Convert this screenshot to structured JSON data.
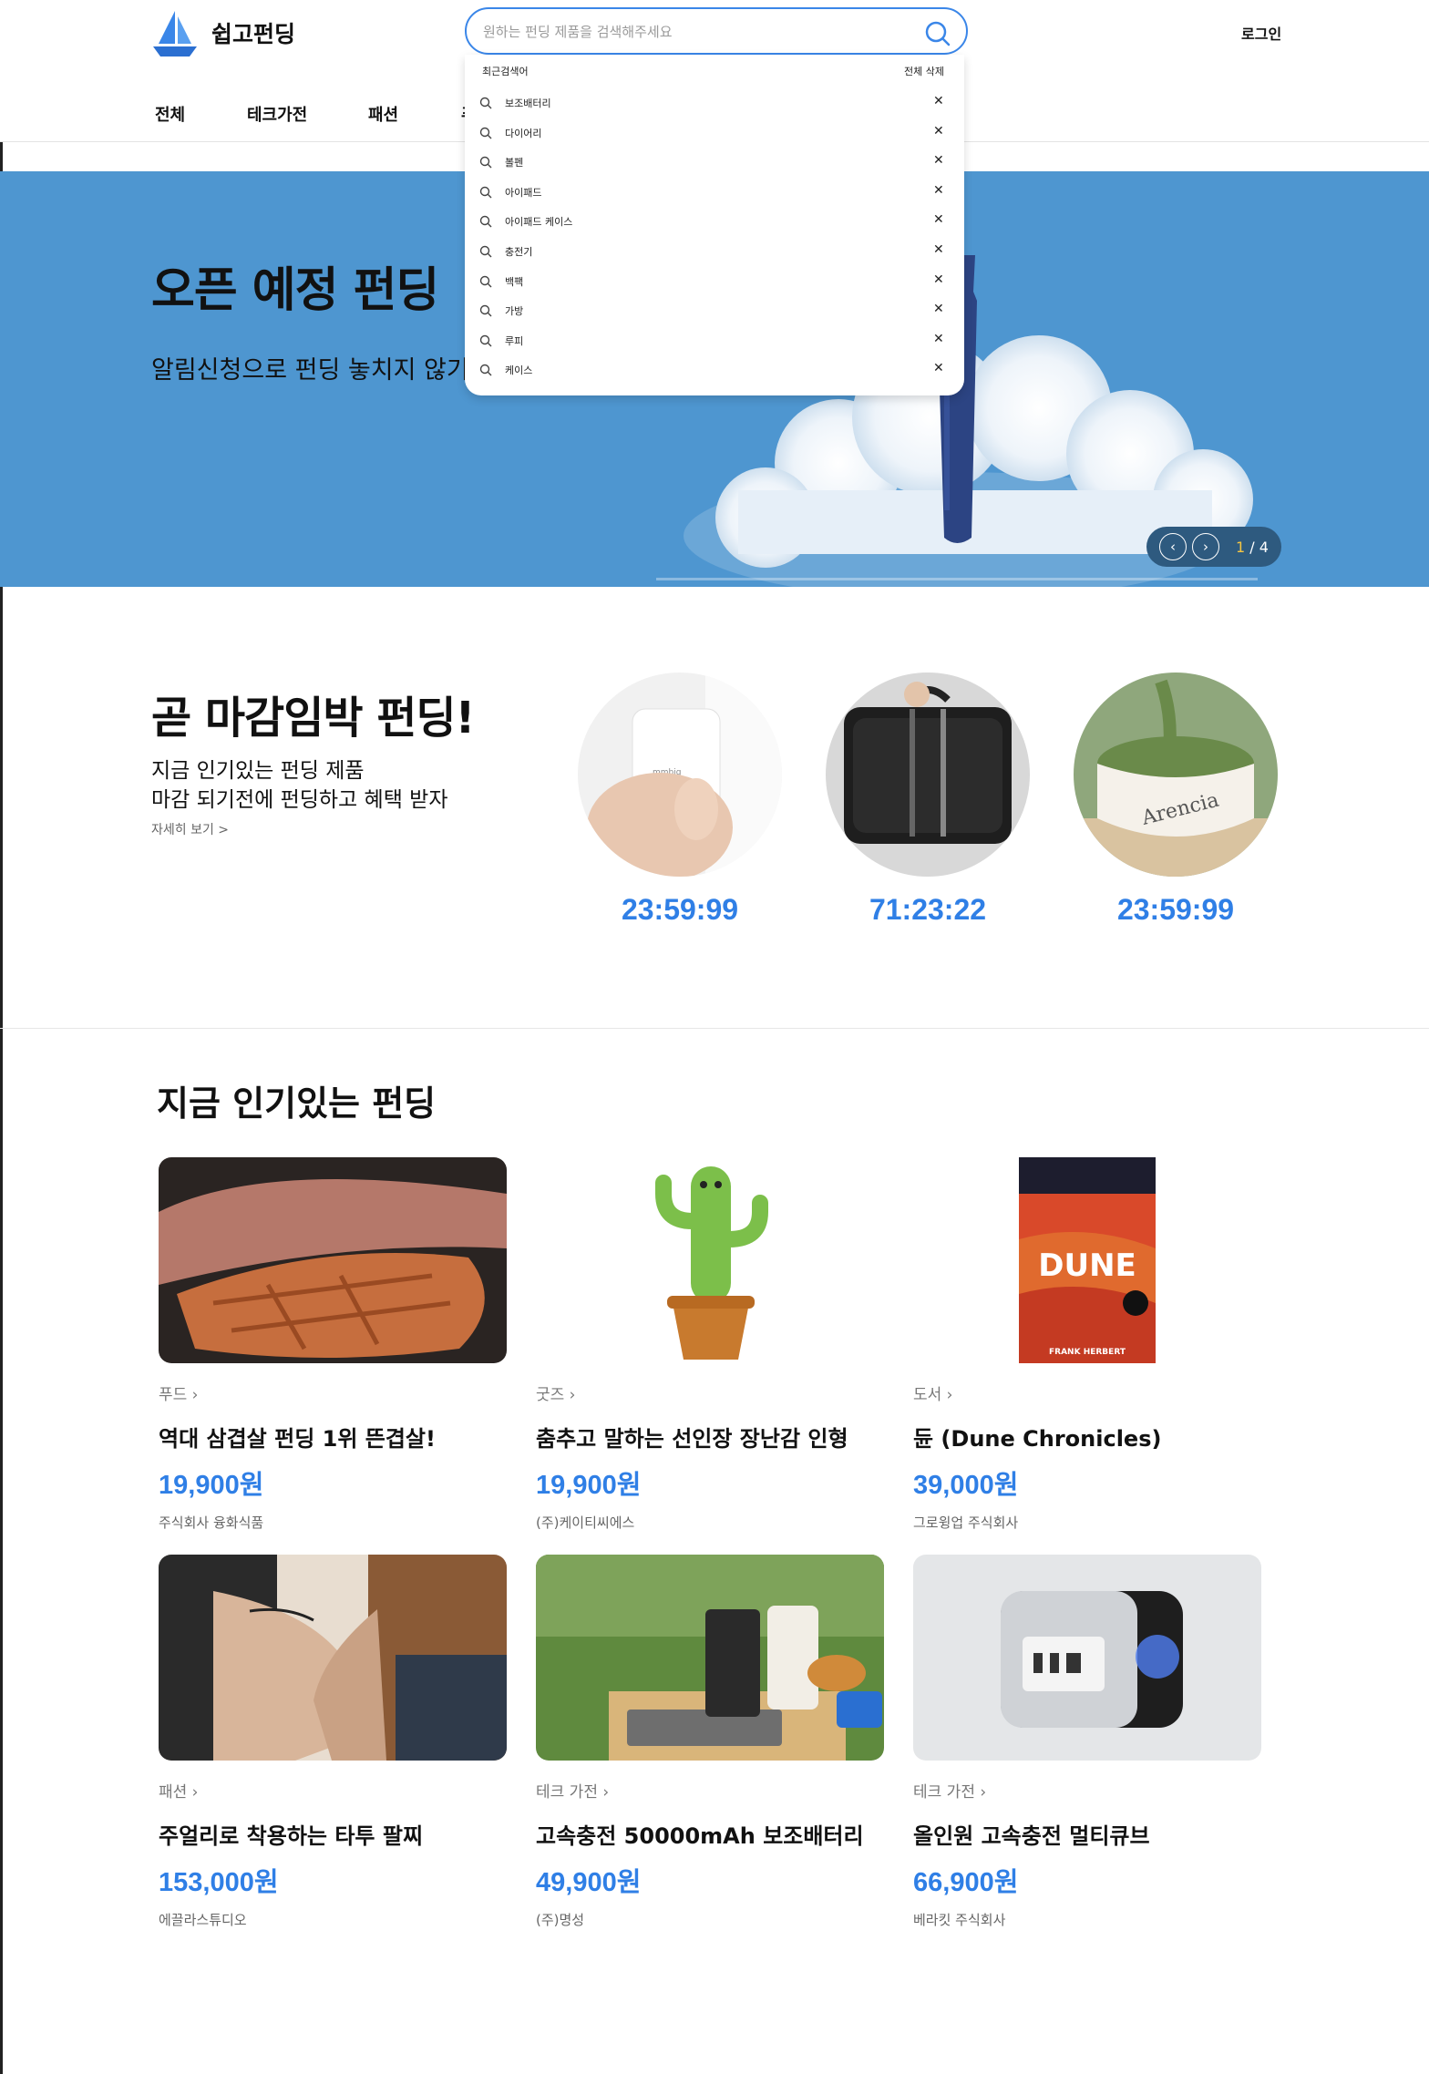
{
  "header": {
    "brand": "쉽고펀딩",
    "search_placeholder": "원하는 펀딩 제품을 검색해주세요",
    "login": "로그인",
    "brand_color": "#3a86e8"
  },
  "nav": [
    "전체",
    "테크가전",
    "패션",
    "푸"
  ],
  "search_dropdown": {
    "title": "최근검색어",
    "clear_all": "전체 삭제",
    "items": [
      "보조배터리",
      "다이어리",
      "볼펜",
      "아이패드",
      "아이패드 케이스",
      "충전기",
      "백팩",
      "가방",
      "루피",
      "케이스"
    ]
  },
  "hero": {
    "title": "오픈 예정 펀딩",
    "subtitle": "알림신청으로 펀딩 놓치지 않기",
    "slide_current": "1",
    "slide_total": "/ 4",
    "bg_color": "#4e96d0"
  },
  "deadline": {
    "title": "곧 마감임박 펀딩!",
    "sub1": "지금 인기있는 펀딩 제품",
    "sub2": "마감 되기전에 펀딩하고 혜택 받자",
    "more": "자세히 보기 >",
    "timers": [
      "23:59:99",
      "71:23:22",
      "23:59:99"
    ]
  },
  "popular": {
    "title": "지금 인기있는 펀딩",
    "items": [
      {
        "category": "푸드  ›",
        "name": "역대 삼겹살 펀딩 1위 뜬겹살!",
        "price": "19,900원",
        "seller": "주식회사 융화식품"
      },
      {
        "category": "굿즈  ›",
        "name": "춤추고 말하는 선인장 장난감 인형",
        "price": "19,900원",
        "seller": "(주)케이티씨에스"
      },
      {
        "category": "도서  ›",
        "name": "듄 (Dune Chronicles)",
        "price": "39,000원",
        "seller": "그로윙업 주식회사"
      },
      {
        "category": "패션  ›",
        "name": "주얼리로 착용하는 타투 팔찌",
        "price": "153,000원",
        "seller": "에끌라스튜디오"
      },
      {
        "category": "테크 가전  ›",
        "name": "고속충전 50000mAh 보조배터리",
        "price": "49,900원",
        "seller": "(주)명성"
      },
      {
        "category": "테크 가전  ›",
        "name": "올인원 고속충전 멀티큐브",
        "price": "66,900원",
        "seller": "베라킷 주식회사"
      }
    ],
    "price_color": "#2f7fe6"
  },
  "dune_cover": {
    "title": "DUNE",
    "author": "FRANK HERBERT"
  },
  "arencia_label": "Arencia"
}
